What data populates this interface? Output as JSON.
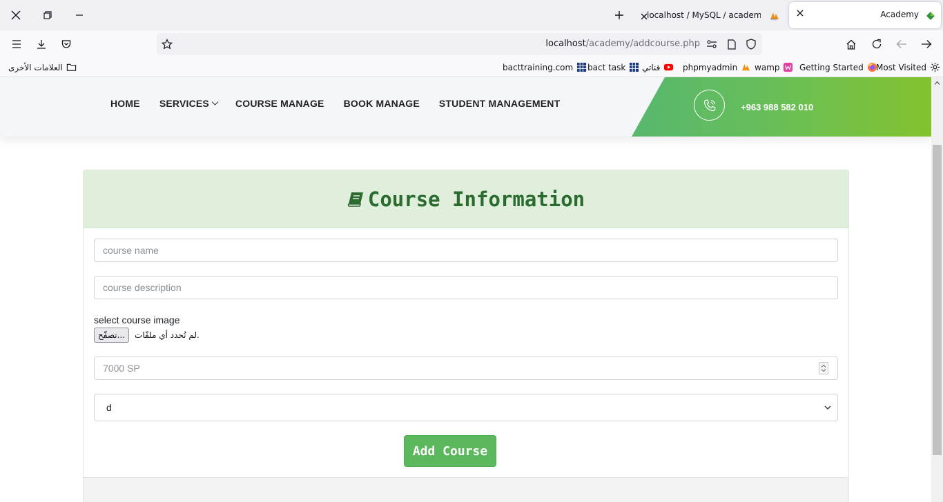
{
  "browser": {
    "tabs": [
      {
        "title": "Academy",
        "active": true
      },
      {
        "title": "localhost / MySQL / academy / ",
        "active": false
      }
    ],
    "url": {
      "host": "localhost",
      "path": "/academy/addcourse.php"
    },
    "bookmarks": [
      {
        "label": "Most Visited",
        "icon": "gear-icon"
      },
      {
        "label": "Getting Started",
        "icon": "firefox-icon"
      },
      {
        "label": "wamp",
        "icon": "wamp-icon"
      },
      {
        "label": "phpmyadmin",
        "icon": "pma-icon"
      },
      {
        "label": "قناتي",
        "icon": "youtube-icon"
      },
      {
        "label": "bact task",
        "icon": "grid-icon"
      },
      {
        "label": "bacttraining.com",
        "icon": "grid-icon"
      }
    ],
    "other_bookmarks": "العلامات الأخرى"
  },
  "header": {
    "menu": [
      "HOME",
      "SERVICES",
      "COURSE MANAGE",
      "BOOK MANAGE",
      "STUDENT MANAGEMENT"
    ],
    "phone": "+963 988 582 010"
  },
  "form": {
    "title": "Course Information",
    "course_name_placeholder": "course name",
    "course_description_placeholder": "course description",
    "image_label": "select course image",
    "browse_button": "تصفّح...",
    "file_status": "لم تُحدد أي ملفّات.",
    "price_placeholder": "7000 SP",
    "category_selected": "d",
    "submit_label": "Add Course"
  },
  "colors": {
    "header_green_start": "#57b76f",
    "header_green_end": "#84c22e",
    "card_head_bg": "#dfefdb",
    "title_color": "#2c6b2f",
    "button_green": "#5cb85c"
  }
}
